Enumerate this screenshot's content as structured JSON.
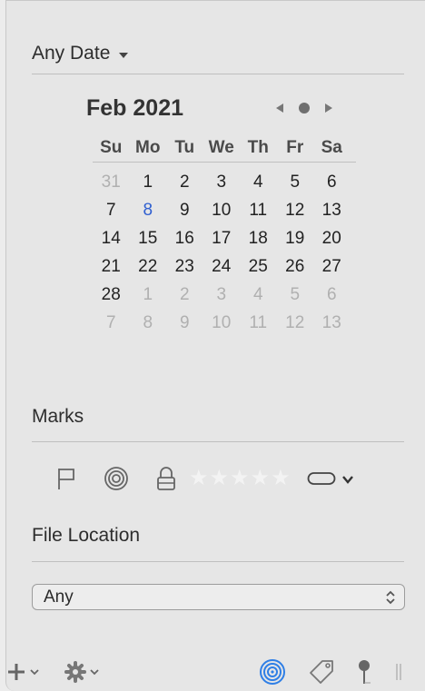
{
  "date_filter": {
    "selected": "Any Date"
  },
  "calendar": {
    "month_label": "Feb 2021",
    "weekdays": [
      "Su",
      "Mo",
      "Tu",
      "We",
      "Th",
      "Fr",
      "Sa"
    ],
    "weeks": [
      [
        {
          "d": "31",
          "s": "dim"
        },
        {
          "d": "1",
          "s": ""
        },
        {
          "d": "2",
          "s": ""
        },
        {
          "d": "3",
          "s": ""
        },
        {
          "d": "4",
          "s": ""
        },
        {
          "d": "5",
          "s": ""
        },
        {
          "d": "6",
          "s": ""
        }
      ],
      [
        {
          "d": "7",
          "s": ""
        },
        {
          "d": "8",
          "s": "today"
        },
        {
          "d": "9",
          "s": ""
        },
        {
          "d": "10",
          "s": ""
        },
        {
          "d": "11",
          "s": ""
        },
        {
          "d": "12",
          "s": ""
        },
        {
          "d": "13",
          "s": ""
        }
      ],
      [
        {
          "d": "14",
          "s": ""
        },
        {
          "d": "15",
          "s": ""
        },
        {
          "d": "16",
          "s": ""
        },
        {
          "d": "17",
          "s": ""
        },
        {
          "d": "18",
          "s": ""
        },
        {
          "d": "19",
          "s": ""
        },
        {
          "d": "20",
          "s": ""
        }
      ],
      [
        {
          "d": "21",
          "s": ""
        },
        {
          "d": "22",
          "s": ""
        },
        {
          "d": "23",
          "s": ""
        },
        {
          "d": "24",
          "s": ""
        },
        {
          "d": "25",
          "s": ""
        },
        {
          "d": "26",
          "s": ""
        },
        {
          "d": "27",
          "s": ""
        }
      ],
      [
        {
          "d": "28",
          "s": ""
        },
        {
          "d": "1",
          "s": "dim"
        },
        {
          "d": "2",
          "s": "dim"
        },
        {
          "d": "3",
          "s": "dim"
        },
        {
          "d": "4",
          "s": "dim"
        },
        {
          "d": "5",
          "s": "dim"
        },
        {
          "d": "6",
          "s": "dim"
        }
      ],
      [
        {
          "d": "7",
          "s": "dim"
        },
        {
          "d": "8",
          "s": "dim"
        },
        {
          "d": "9",
          "s": "dim"
        },
        {
          "d": "10",
          "s": "dim"
        },
        {
          "d": "11",
          "s": "dim"
        },
        {
          "d": "12",
          "s": "dim"
        },
        {
          "d": "13",
          "s": "dim"
        }
      ]
    ]
  },
  "marks": {
    "title": "Marks",
    "icons": [
      "flag-icon",
      "target-icon",
      "lock-icon",
      "star-icon",
      "tag-pill-icon",
      "chevron-down-icon"
    ],
    "rating_stars": 5
  },
  "file_location": {
    "title": "File Location",
    "selected": "Any"
  },
  "toolbar": {
    "icons": [
      "plus-icon",
      "gear-icon",
      "target-icon",
      "tag-icon",
      "pin-icon"
    ]
  },
  "colors": {
    "today": "#2f5fd0",
    "accent_blue": "#2f7fe6"
  }
}
